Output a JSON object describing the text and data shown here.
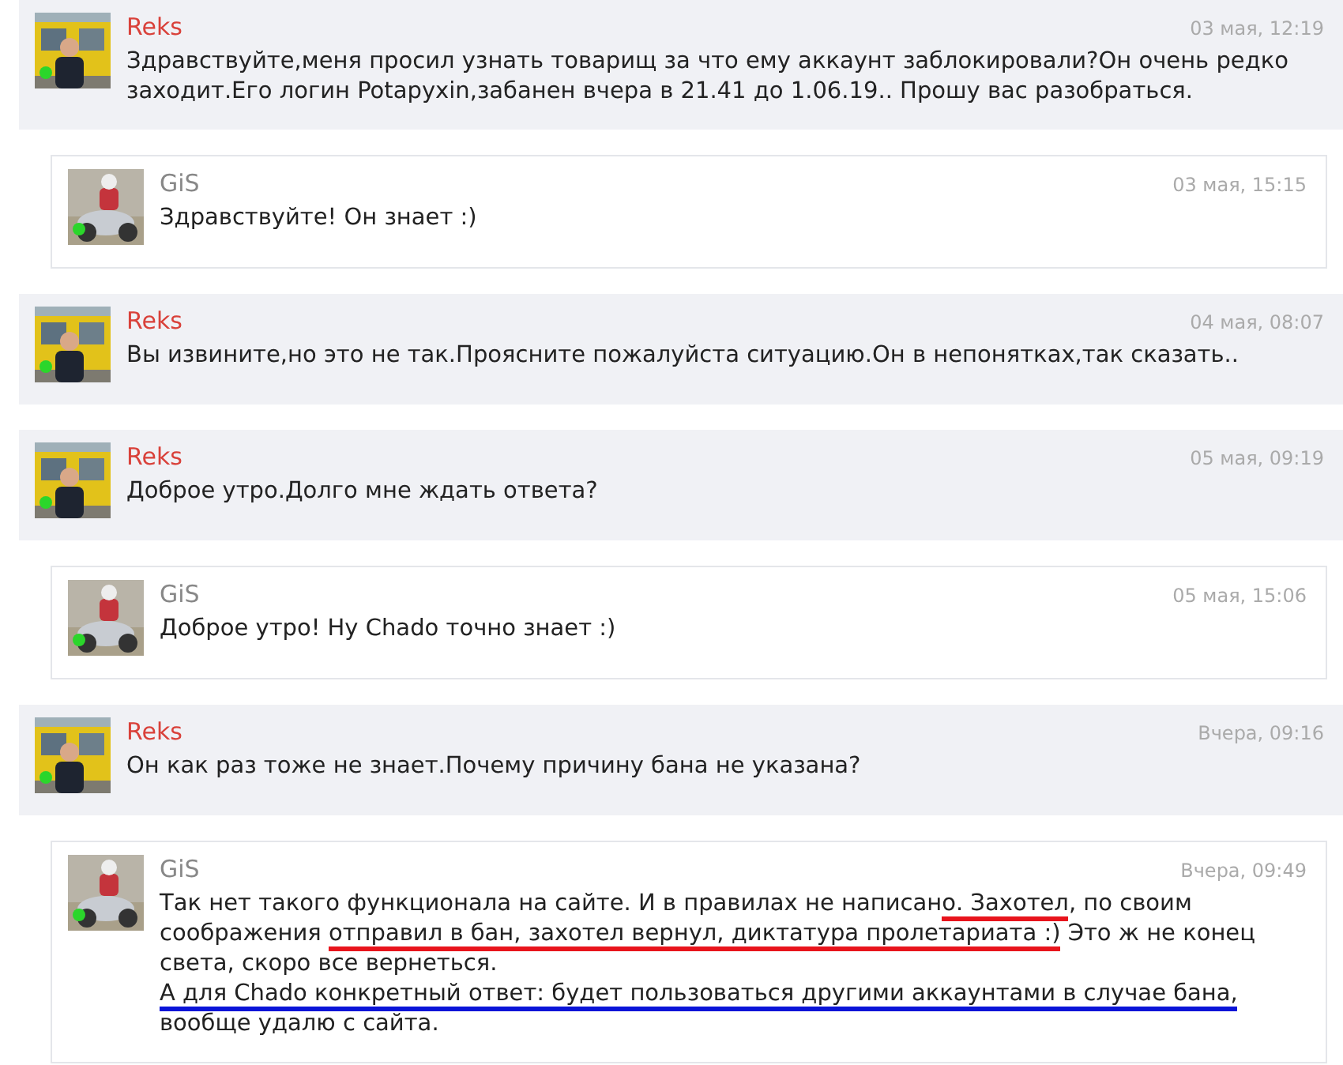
{
  "messages": [
    {
      "kind": "question",
      "author": "Reks",
      "time": "03 мая, 12:19",
      "online": true,
      "paragraphs": [
        [
          {
            "text": "Здравствуйте,меня просил узнать товарищ за что ему аккаунт заблокировали?Он очень редко заходит.Его логин Potapyxin,забанен вчера в 21.41 до 1.06.19.. Прошу вас разобраться."
          }
        ]
      ]
    },
    {
      "kind": "answer",
      "author": "GiS",
      "time": "03 мая, 15:15",
      "online": true,
      "paragraphs": [
        [
          {
            "text": "Здравствуйте! Он знает :)"
          }
        ]
      ]
    },
    {
      "kind": "question",
      "author": "Reks",
      "time": "04 мая, 08:07",
      "online": true,
      "paragraphs": [
        [
          {
            "text": "Вы извините,но это не так.Проясните пожалуйста ситуацию.Он в непонятках,так сказать.."
          }
        ]
      ]
    },
    {
      "kind": "question",
      "author": "Reks",
      "time": "05 мая, 09:19",
      "online": true,
      "paragraphs": [
        [
          {
            "text": "Доброе утро.Долго мне ждать ответа?"
          }
        ]
      ]
    },
    {
      "kind": "answer",
      "author": "GiS",
      "time": "05 мая, 15:06",
      "online": true,
      "paragraphs": [
        [
          {
            "text": "Доброе утро! Ну Chado точно знает :)"
          }
        ]
      ]
    },
    {
      "kind": "question",
      "author": "Reks",
      "time": "Вчера, 09:16",
      "online": true,
      "paragraphs": [
        [
          {
            "text": "Он как раз тоже не знает.Почему причину бана не указана?"
          }
        ]
      ]
    },
    {
      "kind": "answer",
      "author": "GiS",
      "time": "Вчера, 09:49",
      "online": true,
      "paragraphs": [
        [
          {
            "text": "Так нет такого функционала на сайте. И в правилах не написан"
          },
          {
            "text": "о. Захотел",
            "color": "#e8141c"
          },
          {
            "text": ", по своим соображения "
          },
          {
            "text": "отправил в бан, захотел вернул, диктатура пролетариата :)",
            "color": "#e8141c"
          },
          {
            "text": " Это ж не конец света, скоро все вернеться."
          }
        ],
        [
          {
            "text": "А для Chado конкретный ответ: будет пользоваться другими аккаунтами в случае бана,",
            "color": "#0a14d8"
          },
          {
            "text": " вообще удалю с сайта."
          }
        ]
      ]
    }
  ]
}
